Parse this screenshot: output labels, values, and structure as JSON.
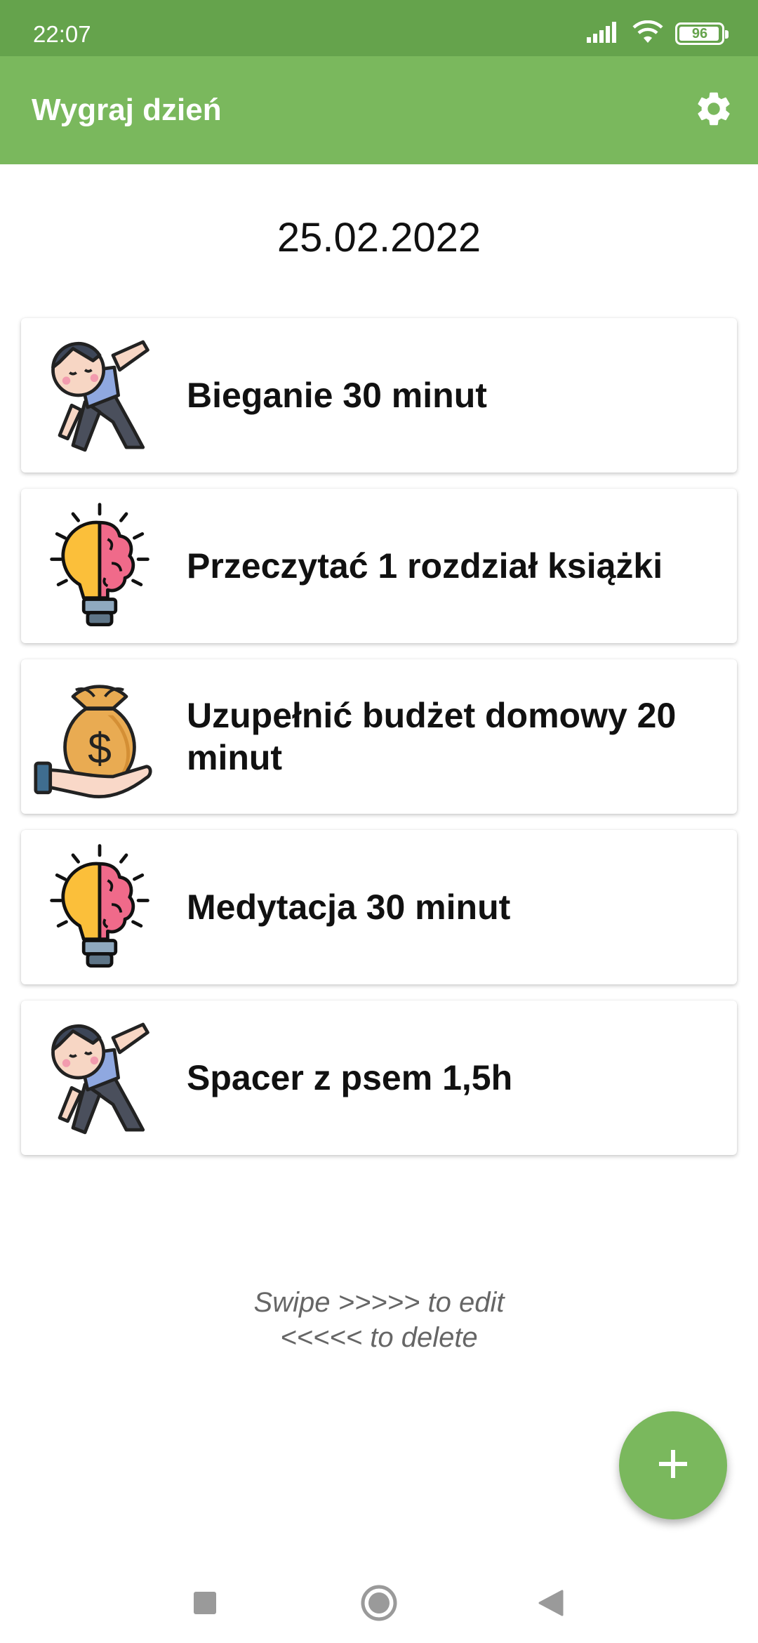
{
  "status_bar": {
    "time": "22:07",
    "battery": "96",
    "battery_level": 0.96
  },
  "app_bar": {
    "title": "Wygraj dzień",
    "settings_icon": "gear-icon"
  },
  "date": "25.02.2022",
  "tasks": [
    {
      "label": "Bieganie 30 minut",
      "icon": "exercise-icon"
    },
    {
      "label": "Przeczytać 1 rozdział książki",
      "icon": "brain-bulb-icon"
    },
    {
      "label": "Uzupełnić budżet domowy 20 minut",
      "icon": "money-bag-icon"
    },
    {
      "label": "Medytacja 30 minut",
      "icon": "brain-bulb-icon"
    },
    {
      "label": "Spacer z psem 1,5h",
      "icon": "exercise-icon"
    }
  ],
  "hint": {
    "line1": "Swipe >>>>> to edit",
    "line2": "<<<<< to delete"
  },
  "fab": {
    "icon": "plus-icon"
  },
  "nav": {
    "recents": "square-icon",
    "home": "circle-icon",
    "back": "triangle-back-icon"
  },
  "colors": {
    "status_bar": "#65a34c",
    "app_bar": "#7ab85d",
    "fab": "#7ab85d"
  }
}
